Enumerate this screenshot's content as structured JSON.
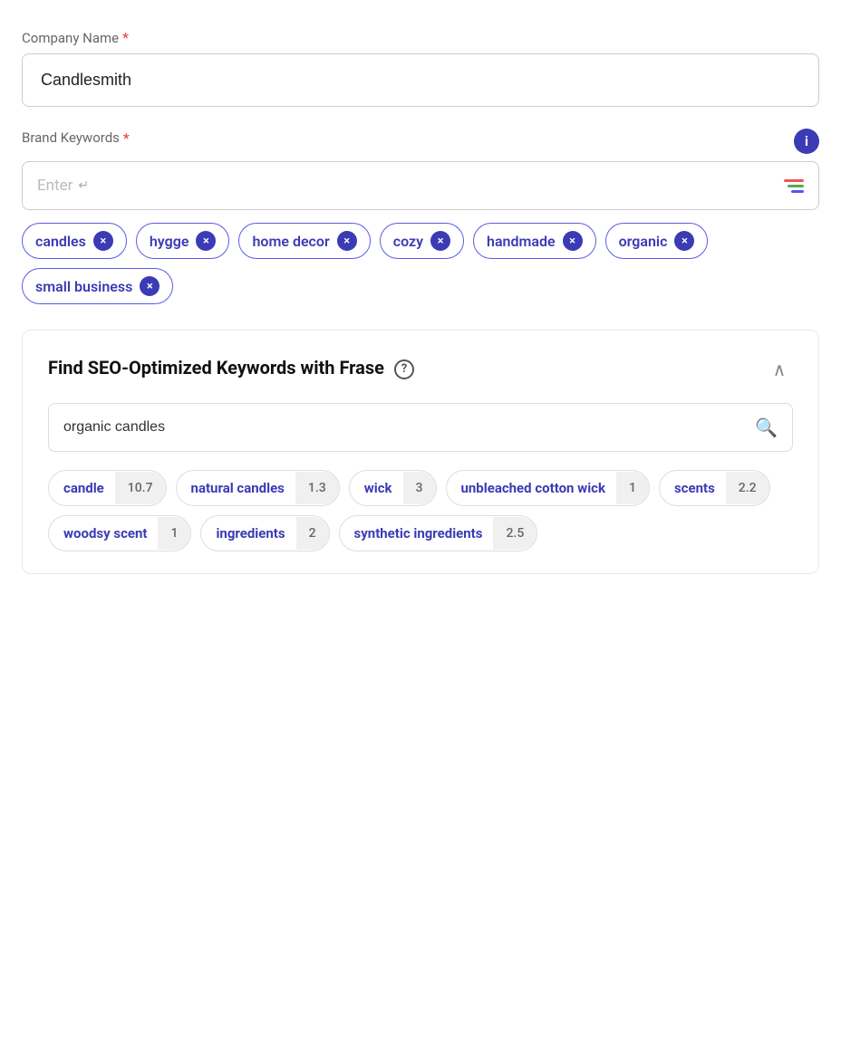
{
  "companyName": {
    "label": "Company Name",
    "required": true,
    "value": "Candlesmith"
  },
  "brandKeywords": {
    "label": "Brand Keywords",
    "required": true,
    "placeholder": "Enter",
    "infoIcon": "i"
  },
  "tags": [
    {
      "id": "candles",
      "label": "candles"
    },
    {
      "id": "hygge",
      "label": "hygge"
    },
    {
      "id": "home-decor",
      "label": "home decor"
    },
    {
      "id": "cozy",
      "label": "cozy"
    },
    {
      "id": "handmade",
      "label": "handmade"
    },
    {
      "id": "organic",
      "label": "organic"
    },
    {
      "id": "small-business",
      "label": "small business"
    }
  ],
  "seoPanel": {
    "title": "Find SEO-Optimized Keywords with Frase",
    "searchValue": "organic candles",
    "searchPlaceholder": "organic candles",
    "chips": [
      {
        "id": "candle",
        "label": "candle",
        "score": "10.7"
      },
      {
        "id": "natural-candles",
        "label": "natural candles",
        "score": "1.3"
      },
      {
        "id": "wick",
        "label": "wick",
        "score": "3"
      },
      {
        "id": "unbleached-cotton-wick",
        "label": "unbleached cotton wick",
        "score": "1"
      },
      {
        "id": "scents",
        "label": "scents",
        "score": "2.2"
      },
      {
        "id": "woodsy-scent",
        "label": "woodsy scent",
        "score": "1"
      },
      {
        "id": "ingredients",
        "label": "ingredients",
        "score": "2"
      },
      {
        "id": "synthetic-ingredients",
        "label": "synthetic ingredients",
        "score": "2.5"
      }
    ]
  }
}
